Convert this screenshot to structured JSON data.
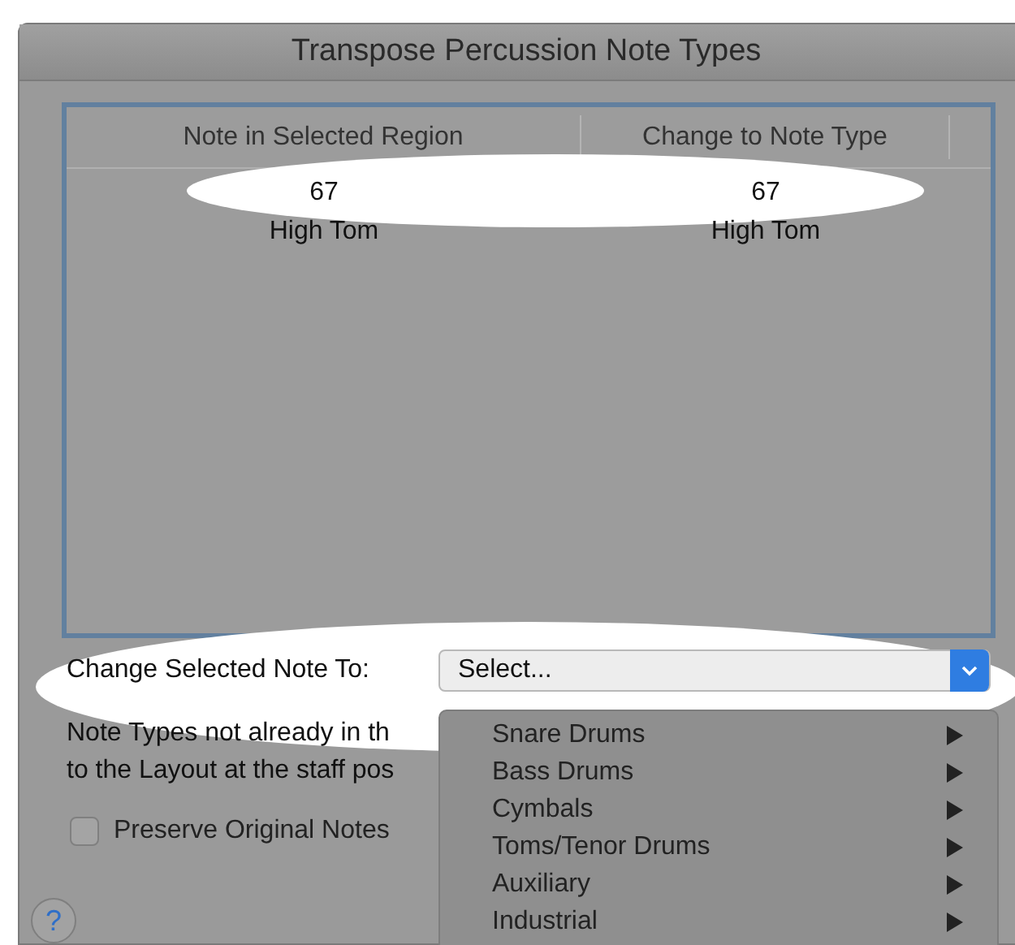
{
  "window": {
    "title": "Transpose Percussion Note Types"
  },
  "table": {
    "columns": [
      "Note in Selected Region",
      "Change to Note Type"
    ],
    "rows": [
      {
        "cells": [
          {
            "number": "67",
            "name": "High Tom"
          },
          {
            "number": "67",
            "name": "High Tom"
          }
        ]
      }
    ]
  },
  "change_selected": {
    "label": "Change Selected Note To:",
    "value": "Select..."
  },
  "note_text": [
    "Note Types not already in th",
    "to the Layout at the staff pos"
  ],
  "preserve_checkbox": {
    "label": "Preserve Original Notes",
    "checked": false
  },
  "help_button": "?",
  "menu": {
    "items": [
      {
        "label": "Snare Drums",
        "has_submenu": true
      },
      {
        "label": "Bass Drums",
        "has_submenu": true
      },
      {
        "label": "Cymbals",
        "has_submenu": true
      },
      {
        "label": "Toms/Tenor Drums",
        "has_submenu": true
      },
      {
        "label": "Auxiliary",
        "has_submenu": true
      },
      {
        "label": "Industrial",
        "has_submenu": true
      }
    ]
  }
}
